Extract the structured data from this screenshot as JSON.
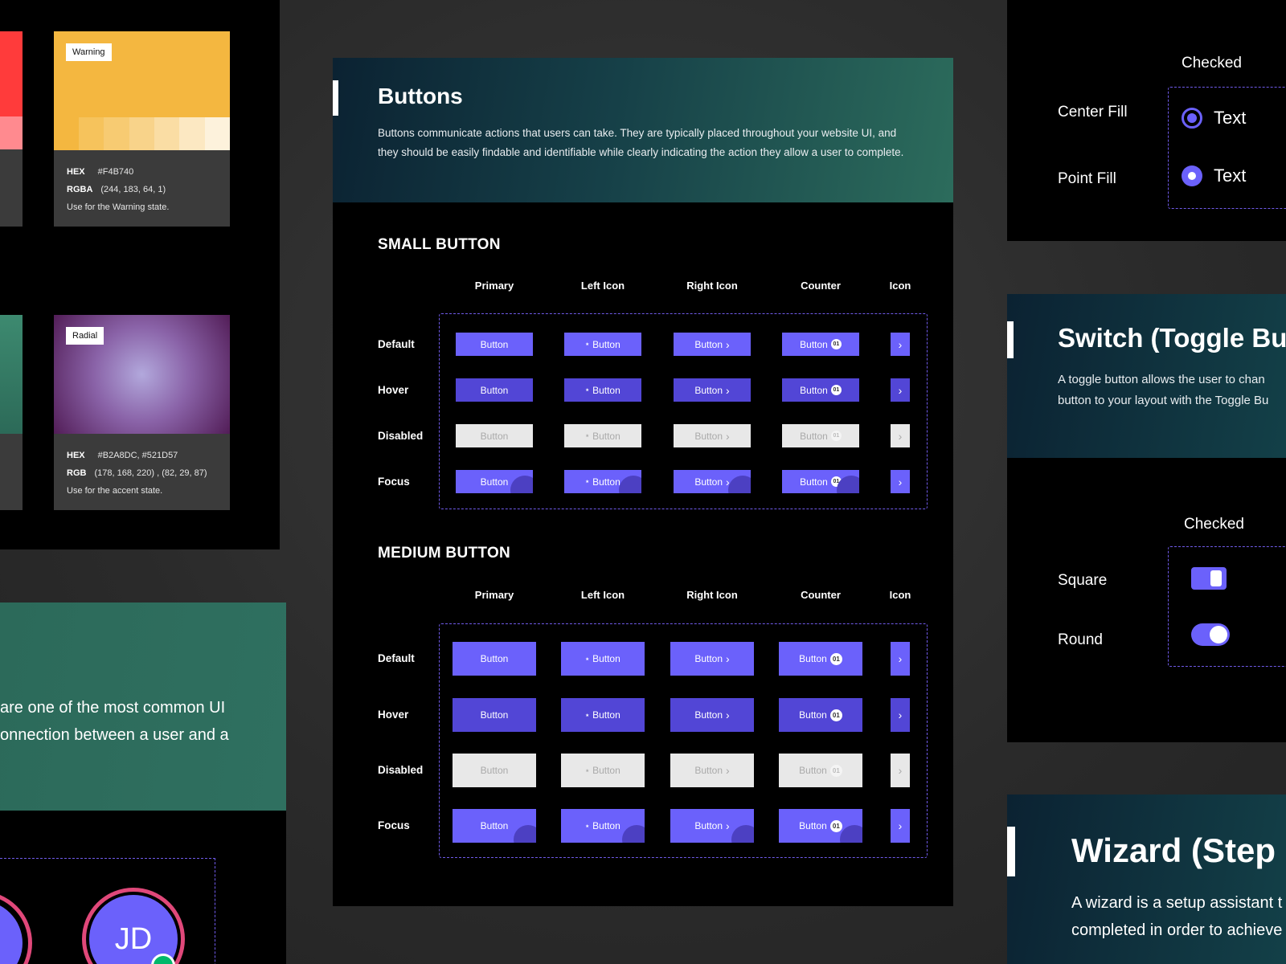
{
  "colors": {
    "warning": {
      "tag": "Warning",
      "hex_label": "HEX",
      "hex": "#F4B740",
      "rgba_label": "RGBA",
      "rgba": "(244, 183, 64, 1)",
      "usage": "Use for the Warning state."
    },
    "radial": {
      "tag": "Radial",
      "hex_label": "HEX",
      "hex": "#B2A8DC, #521D57",
      "rgb_label": "RGB",
      "rgb": "(178, 168, 220) , (82, 29, 87)",
      "usage": "Use for the accent state."
    }
  },
  "left_text": {
    "line1": "are one of the most common UI",
    "line2": "onnection between a user and a"
  },
  "avatar": {
    "initials": "JD"
  },
  "buttons_card": {
    "title": "Buttons",
    "description": "Buttons communicate actions that users can take. They are typically placed throughout your website UI, and they should be easily findable and identifiable while clearly indicating the action they allow a user to complete.",
    "small_title": "SMALL BUTTON",
    "medium_title": "MEDIUM  BUTTON",
    "columns": [
      "Primary",
      "Left Icon",
      "Right Icon",
      "Counter",
      "Icon"
    ],
    "states": [
      "Default",
      "Hover",
      "Disabled",
      "Focus"
    ],
    "button_label": "Button",
    "counter_value": "01"
  },
  "radio_panel": {
    "checked_label": "Checked",
    "rows": [
      {
        "label": "Center Fill",
        "text": "Text"
      },
      {
        "label": "Point Fill",
        "text": "Text"
      }
    ]
  },
  "switch_panel": {
    "title": "Switch (Toggle Bu",
    "desc_line1": "A toggle button allows the user to chan",
    "desc_line2": "button to your layout with the Toggle Bu",
    "checked_label": "Checked",
    "rows": [
      {
        "label": "Square"
      },
      {
        "label": "Round"
      }
    ]
  },
  "wizard_panel": {
    "title": "Wizard (Step",
    "desc_line1": "A wizard is a setup assistant t",
    "desc_line2": "completed in order to achieve"
  },
  "theme": {
    "accent": "#6B61FB",
    "hover": "#5246D6",
    "warning": "#F4B740",
    "dash": "#6F5AE8"
  }
}
